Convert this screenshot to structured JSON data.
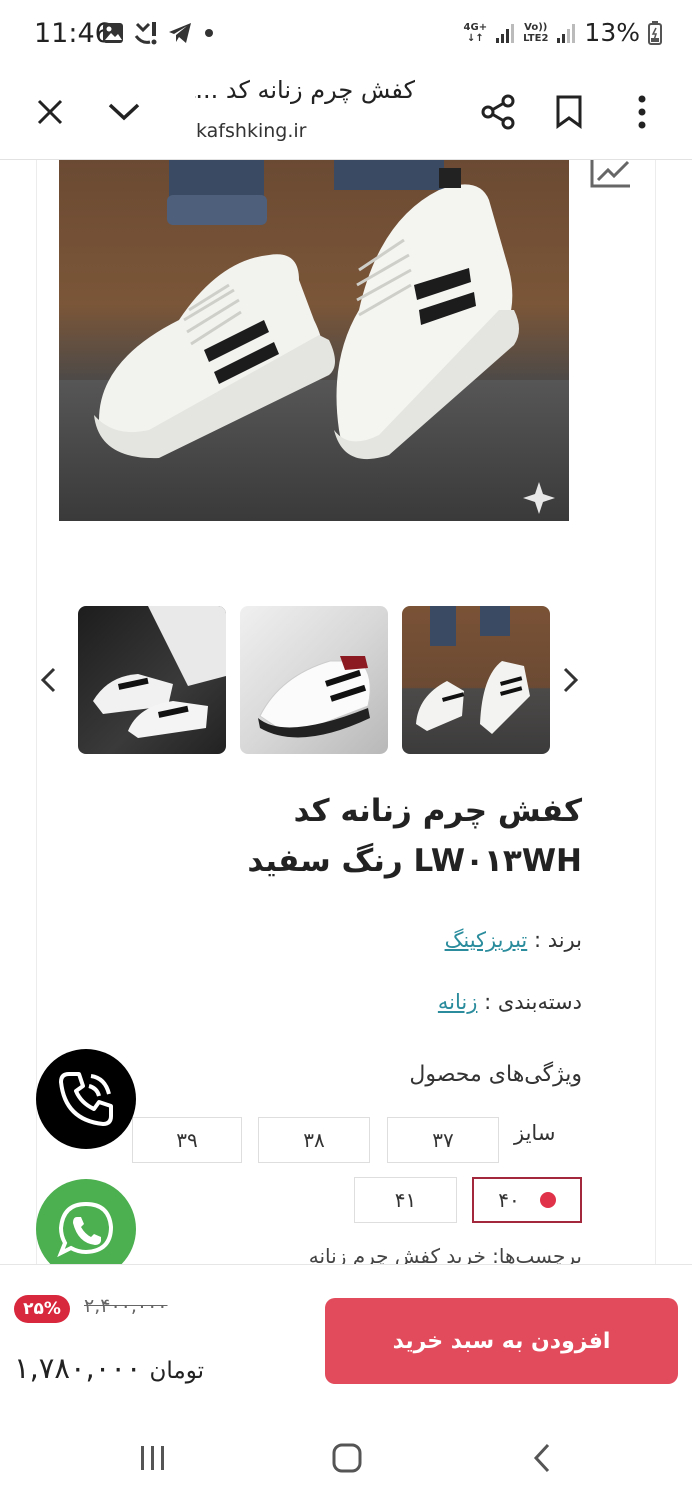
{
  "status_bar": {
    "time": "11:46",
    "network_label_top": "4G+",
    "volte_label_top": "Vo))",
    "volte_label_bottom": "LTE2",
    "battery": "13%",
    "icons": [
      "image-icon",
      "missed-call-icon",
      "telegram-icon",
      "dot-icon",
      "signal-icon",
      "battery-icon"
    ]
  },
  "toolbar": {
    "title": "کفش چرم زنانه کد ...L",
    "url": "kafshking.ir",
    "icons": [
      "close-icon",
      "chevron-down-icon",
      "share-icon",
      "bookmark-icon",
      "more-vert-icon"
    ]
  },
  "product": {
    "title": "کفش چرم زنانه کد LW۰۱۳WH رنگ سفید",
    "brand_label": "برند :",
    "brand_value": "تبریزکینگ",
    "category_label": "دسته‌بندی :",
    "category_value": "زنانه",
    "features_title": "ویژگی‌های محصول",
    "size_label": "سایز",
    "sizes": [
      "۳۷",
      "۳۸",
      "۳۹",
      "۴۰",
      "۴۱"
    ],
    "selected_size": "۴۰",
    "tags_line": "برچسب‌ها: خرید کفش چرم زنانه"
  },
  "purchase": {
    "discount": "۲۵%",
    "old_price": "۲,۴۰۰,۰۰۰",
    "price": "۱,۷۸۰,۰۰۰",
    "currency": "تومان",
    "add_to_cart": "افزودن به سبد خرید"
  },
  "colors": {
    "accent": "#e24b5b",
    "badge": "#d8283e",
    "link": "#2a8c9c",
    "whatsapp": "#4caf50",
    "call": "#000000"
  }
}
